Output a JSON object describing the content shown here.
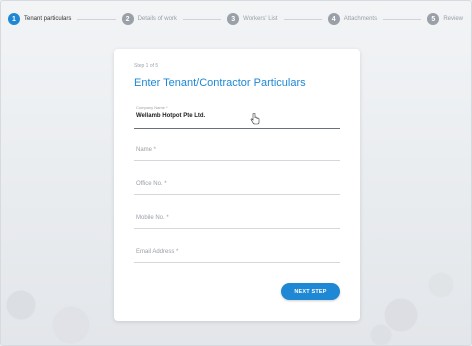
{
  "stepper": {
    "steps": [
      {
        "number": "1",
        "label": "Tenant particulars"
      },
      {
        "number": "2",
        "label": "Details of work"
      },
      {
        "number": "3",
        "label": "Workers' List"
      },
      {
        "number": "4",
        "label": "Attachments"
      },
      {
        "number": "5",
        "label": "Review"
      }
    ],
    "active_step": "1"
  },
  "form": {
    "step_count": "Step 1 of 5",
    "title": "Enter Tenant/Contractor Particulars",
    "company_name": {
      "label": "Company Name *",
      "value": "Wellamb Hotpot Pte Ltd."
    },
    "name": {
      "placeholder": "Name *"
    },
    "office_no": {
      "placeholder": "Office No. *"
    },
    "mobile_no": {
      "placeholder": "Mobile No. *"
    },
    "email": {
      "placeholder": "Email Address *"
    },
    "next_button": "NEXT STEP"
  },
  "colors": {
    "accent": "#1e88d4",
    "inactive": "#9aa0a8",
    "background": "#eef0f3"
  }
}
